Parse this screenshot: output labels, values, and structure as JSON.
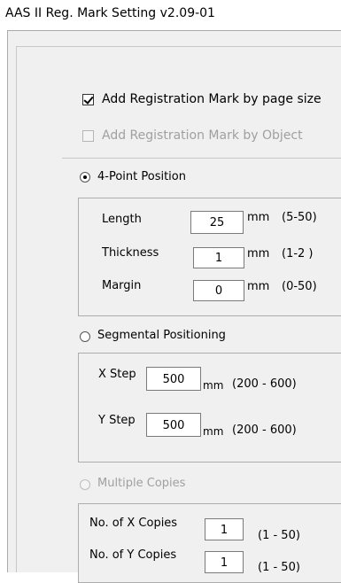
{
  "window": {
    "title": "AAS II Reg. Mark Setting v2.09-01"
  },
  "options": {
    "add_by_page_size": {
      "label": "Add Registration Mark by page size",
      "checked": true
    },
    "add_by_object": {
      "label": "Add Registration Mark by Object",
      "checked": false,
      "disabled": true
    }
  },
  "four_point": {
    "label": "4-Point Position",
    "selected": true,
    "length": {
      "label": "Length",
      "value": "25",
      "unit": "mm",
      "range": "(5-50)"
    },
    "thickness": {
      "label": "Thickness",
      "value": "1",
      "unit": "mm",
      "range": "(1-2 )"
    },
    "margin": {
      "label": "Margin",
      "value": "0",
      "unit": "mm",
      "range": "(0-50)"
    }
  },
  "segmental": {
    "label": "Segmental Positioning",
    "selected": false,
    "x_step": {
      "label": "X Step",
      "value": "500",
      "unit": "mm",
      "range": "(200 - 600)"
    },
    "y_step": {
      "label": "Y Step",
      "value": "500",
      "unit": "mm",
      "range": "(200 - 600)"
    }
  },
  "multiple": {
    "label": "Multiple Copies",
    "selected": false,
    "disabled": true,
    "x_copies": {
      "label": "No. of X Copies",
      "value": "1",
      "range": "(1 - 50)"
    },
    "y_copies": {
      "label": "No. of Y Copies",
      "value": "1",
      "range": "(1 - 50)"
    }
  }
}
